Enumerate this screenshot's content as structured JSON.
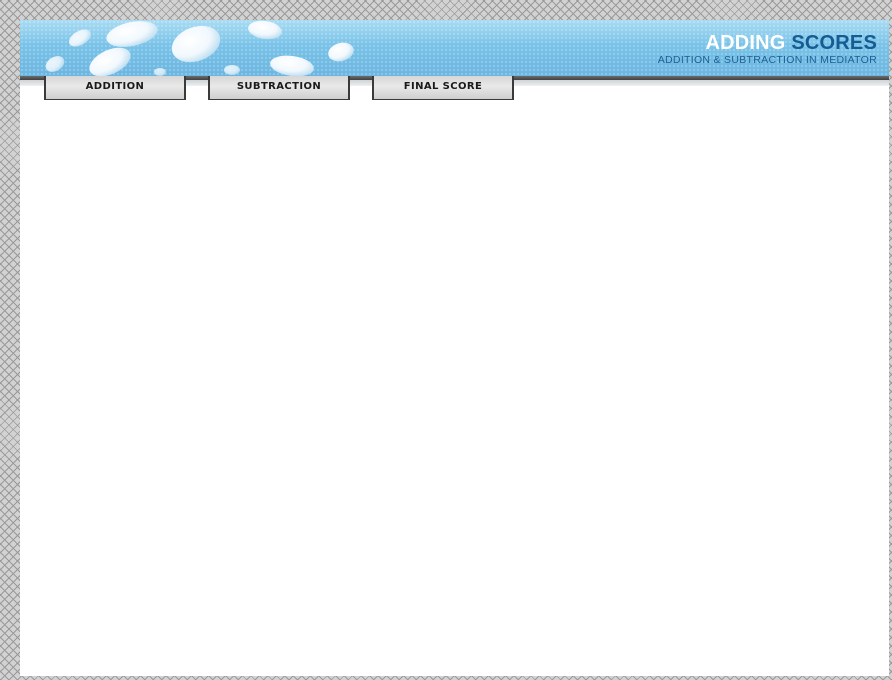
{
  "header": {
    "title_part1": "ADDING",
    "title_part2": "SCORES",
    "subtitle": "ADDITION & SUBTRACTION IN MEDIATOR",
    "banner_color": "#79c2e8",
    "title_accent_color": "#155c93"
  },
  "nav": {
    "tabs": [
      {
        "label": "ADDITION"
      },
      {
        "label": "SUBTRACTION"
      },
      {
        "label": "FINAL SCORE"
      }
    ]
  }
}
